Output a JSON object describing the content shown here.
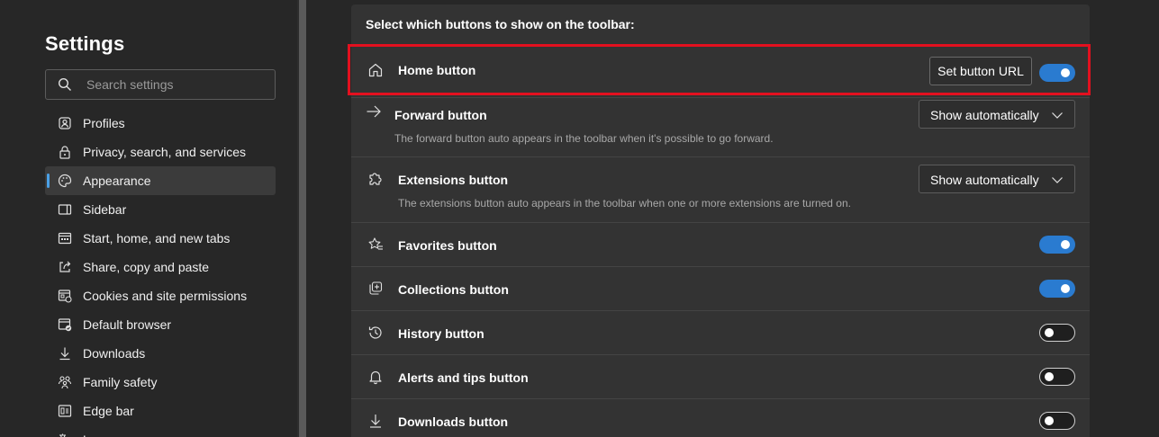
{
  "sidebar": {
    "title": "Settings",
    "search": {
      "placeholder": "Search settings",
      "value": ""
    },
    "items": [
      {
        "label": "Profiles",
        "icon": "profile-icon"
      },
      {
        "label": "Privacy, search, and services",
        "icon": "lock-icon"
      },
      {
        "label": "Appearance",
        "icon": "palette-icon",
        "active": true
      },
      {
        "label": "Sidebar",
        "icon": "sidebar-icon"
      },
      {
        "label": "Start, home, and new tabs",
        "icon": "home-tabs-icon"
      },
      {
        "label": "Share, copy and paste",
        "icon": "share-icon"
      },
      {
        "label": "Cookies and site permissions",
        "icon": "cookies-icon"
      },
      {
        "label": "Default browser",
        "icon": "default-browser-icon"
      },
      {
        "label": "Downloads",
        "icon": "download-icon"
      },
      {
        "label": "Family safety",
        "icon": "family-icon"
      },
      {
        "label": "Edge bar",
        "icon": "edge-bar-icon"
      },
      {
        "label": "L",
        "icon": "language-icon"
      }
    ]
  },
  "toolbar_section": {
    "header": "Select which buttons to show on the toolbar:",
    "rows": [
      {
        "title": "Home button",
        "icon": "home-icon",
        "control": "toggle",
        "on": true,
        "button_label": "Set button URL"
      },
      {
        "title": "Forward button",
        "icon": "arrow-right-icon",
        "control": "select",
        "value": "Show automatically",
        "description": "The forward button auto appears in the toolbar when it's possible to go forward."
      },
      {
        "title": "Extensions button",
        "icon": "puzzle-icon",
        "control": "select",
        "value": "Show automatically",
        "description": "The extensions button auto appears in the toolbar when one or more extensions are turned on."
      },
      {
        "title": "Favorites button",
        "icon": "star-icon",
        "control": "toggle",
        "on": true
      },
      {
        "title": "Collections button",
        "icon": "collections-icon",
        "control": "toggle",
        "on": true
      },
      {
        "title": "History button",
        "icon": "history-icon",
        "control": "toggle",
        "on": false
      },
      {
        "title": "Alerts and tips button",
        "icon": "bell-icon",
        "control": "toggle",
        "on": false
      },
      {
        "title": "Downloads button",
        "icon": "download-icon",
        "control": "toggle",
        "on": false
      }
    ]
  },
  "colors": {
    "accent": "#2a7bd0",
    "highlight": "#e3101f",
    "background": "#272727",
    "card": "#333333"
  }
}
